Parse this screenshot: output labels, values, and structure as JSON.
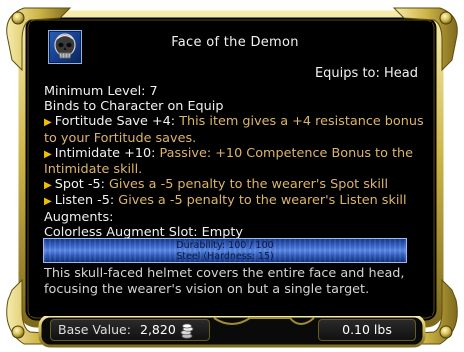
{
  "item": {
    "icon": "skull-helmet-icon",
    "name": "Face of the Demon",
    "equips_to": "Equips to: Head",
    "minimum_level": "Minimum Level: 7",
    "binds": "Binds to Character on Equip"
  },
  "effects": [
    {
      "name": "Fortitude Save +4:",
      "description": "This item gives a +4 resistance bonus to your Fortitude saves."
    },
    {
      "name": "Intimidate +10:",
      "description": "Passive: +10 Competence Bonus to the Intimidate skill."
    },
    {
      "name": "Spot -5:",
      "description": "Gives a -5 penalty to the wearer's Spot skill"
    },
    {
      "name": "Listen -5:",
      "description": "Gives a -5 penalty to the wearer's Listen skill"
    }
  ],
  "augments": {
    "header": "Augments:",
    "slot": "Colorless Augment Slot: Empty"
  },
  "durability": {
    "text": "Durability: 100 / 100",
    "material": "Steel (Hardness: 15)",
    "fraction": 1.0
  },
  "description": "This skull-faced helmet covers the entire face and head, focusing the wearer's vision on but a single target.",
  "footer": {
    "base_value_label": "Base Value:",
    "base_value": "2,820",
    "currency_icon": "coin-stack-icon",
    "weight": "0.10 lbs"
  },
  "colors": {
    "gold_frame": "#d8c25a",
    "effect_text": "#ddb56a",
    "bullet": "#f0c000",
    "durability_bar": "#3b67cf"
  }
}
